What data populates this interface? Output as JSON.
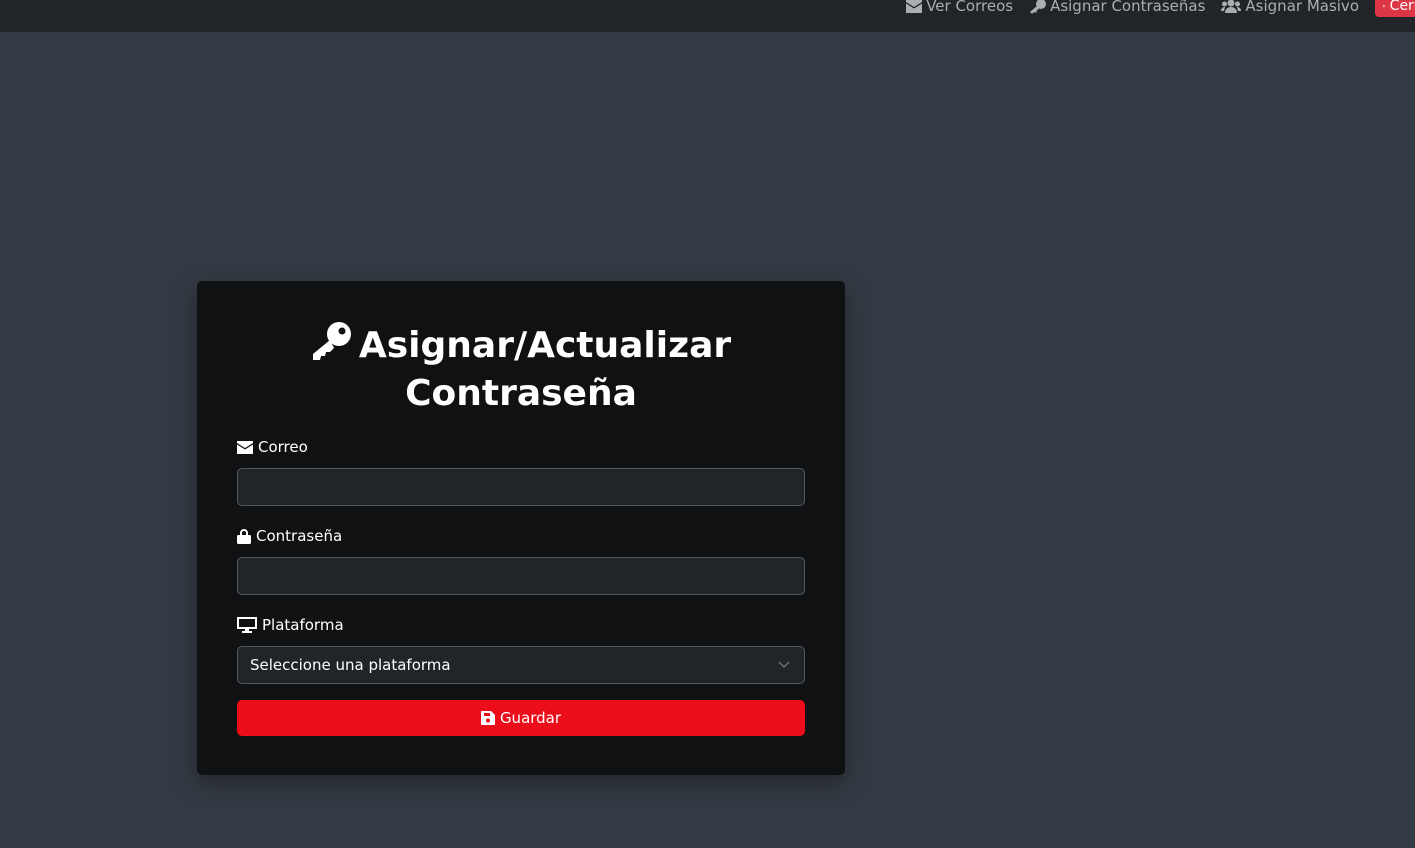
{
  "navbar": {
    "links": [
      {
        "label": "Ver Correos",
        "icon": "envelope-icon"
      },
      {
        "label": "Asignar Contraseñas",
        "icon": "key-icon"
      },
      {
        "label": "Asignar Masivo",
        "icon": "users-icon"
      }
    ],
    "logout_label": "Cerrar S"
  },
  "form": {
    "title_line1": "Asignar/Actualizar",
    "title_line2": "Contraseña",
    "email_label": "Correo",
    "email_value": "",
    "password_label": "Contraseña",
    "password_value": "",
    "platform_label": "Plataforma",
    "platform_selected": "Seleccione una plataforma",
    "save_label": "Guardar"
  },
  "colors": {
    "page_bg": "#343a43",
    "navbar_bg": "#212529",
    "card_bg": "#101113",
    "primary_button": "#ec0c1a",
    "logout_button": "#dc3545"
  }
}
